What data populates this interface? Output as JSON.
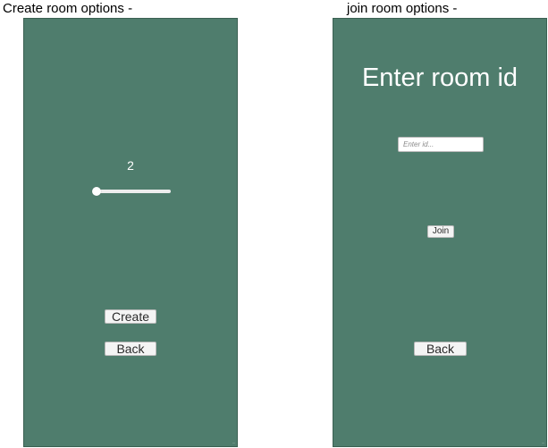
{
  "left_panel": {
    "caption": "Create room options -",
    "slider": {
      "value_label": "2",
      "position_fraction": 0.0
    },
    "create_button": "Create",
    "back_button": "Back"
  },
  "right_panel": {
    "caption": "join room options -",
    "title": "Enter room id",
    "id_input": {
      "placeholder": "Enter id...",
      "value": ""
    },
    "join_button": "Join",
    "back_button": "Back"
  },
  "colors": {
    "screen_background": "#4f7d6d",
    "button_background": "#f4f4f4",
    "text_light": "#ffffff"
  }
}
